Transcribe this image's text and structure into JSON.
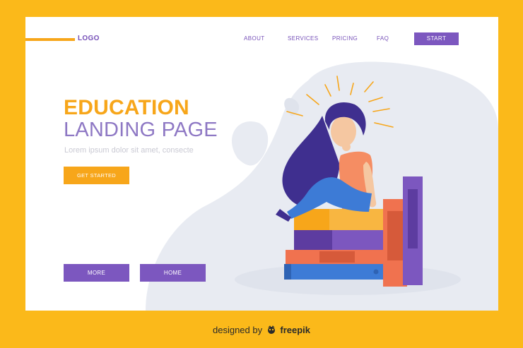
{
  "header": {
    "logo_label": "LOGO",
    "nav": [
      "ABOUT",
      "SERVICES",
      "PRICING",
      "FAQ"
    ],
    "start_label": "START"
  },
  "hero": {
    "title": "EDUCATION",
    "subtitle": "LANDING PAGE",
    "lorem": "Lorem ipsum dolor sit amet, consecte",
    "cta_label": "GET STARTED"
  },
  "footer_buttons": {
    "more_label": "MORE",
    "home_label": "HOME"
  },
  "credit": {
    "prefix": "designed by",
    "brand": "freepik"
  },
  "colors": {
    "background": "#fbb91a",
    "accent_orange": "#f7a61a",
    "accent_purple": "#7c57bf"
  },
  "icons": [
    "freepik-logo-icon"
  ],
  "illustration": "girl-sitting-on-books-illustration"
}
